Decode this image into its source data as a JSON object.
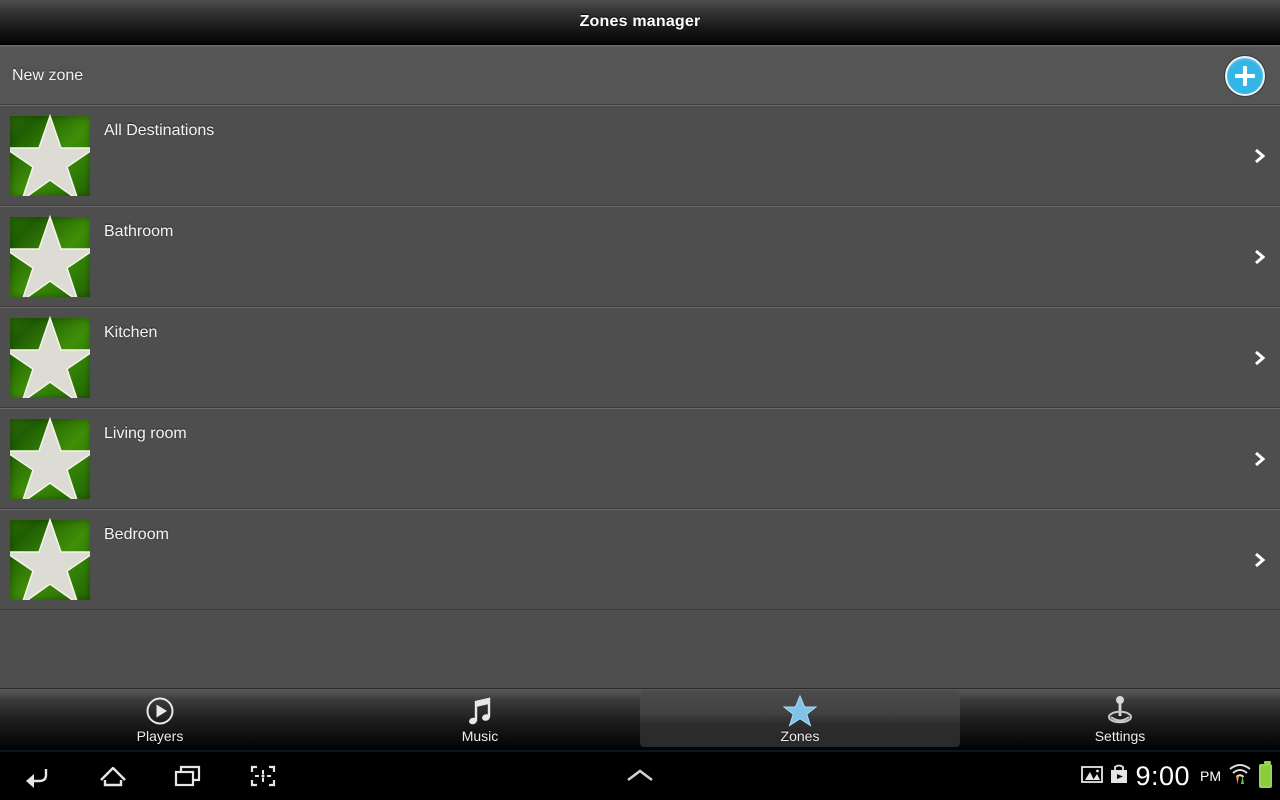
{
  "titlebar": {
    "title": "Zones manager"
  },
  "header": {
    "new_zone_label": "New zone",
    "add_icon": "plus-icon",
    "accent_color": "#33b5e5"
  },
  "zone_list": {
    "row_icon": "green-star-icon",
    "row_chevron_icon": "chevron-right-icon",
    "items": [
      {
        "name": "All Destinations"
      },
      {
        "name": "Bathroom"
      },
      {
        "name": "Kitchen"
      },
      {
        "name": "Living room"
      },
      {
        "name": "Bedroom"
      }
    ]
  },
  "tabbar": {
    "active_tab": "Zones",
    "tabs": [
      {
        "label": "Players",
        "icon": "play-circle-icon",
        "active": false
      },
      {
        "label": "Music",
        "icon": "music-note-icon",
        "active": false
      },
      {
        "label": "Zones",
        "icon": "star-icon",
        "active": true
      },
      {
        "label": "Settings",
        "icon": "joystick-icon",
        "active": false
      }
    ]
  },
  "navbar": {
    "buttons": [
      {
        "icon": "back-icon"
      },
      {
        "icon": "home-icon"
      },
      {
        "icon": "recents-icon"
      },
      {
        "icon": "screenshot-icon"
      }
    ],
    "expand_icon": "chevron-up-icon",
    "status": {
      "image_icon": "image-icon",
      "bag_icon": "shopping-bag-icon",
      "wifi_icon": "wifi-transfer-icon",
      "battery_icon": "battery-full-icon",
      "time": "9:00",
      "ampm": "PM"
    }
  },
  "colors": {
    "page_background": "#4e4e4e",
    "star_fill": "#dcdcd4",
    "star_tile_green": "#2e7a05",
    "tab_star_blue": "#7fc3e8",
    "battery_green": "#8ccb3a"
  }
}
